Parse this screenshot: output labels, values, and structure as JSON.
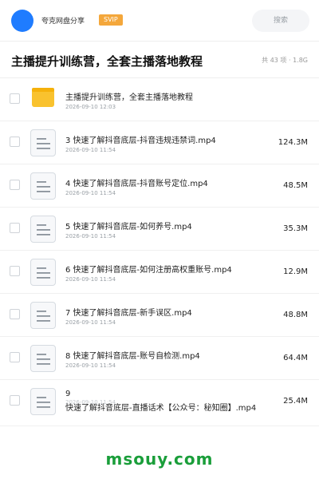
{
  "header": {
    "brand": "夸克网盘分享",
    "badge": "SVIP",
    "search_placeholder": "搜索"
  },
  "share": {
    "title": "主播提升训练营，全套主播落地教程",
    "summary": "共 43 项 · 1.8G"
  },
  "files": [
    {
      "name": "主播提升训练营，全套主播落地教程",
      "date": "2026-09-10 12:03",
      "size": "",
      "icon": "folder-icon"
    },
    {
      "name": "3 快速了解抖音底层-抖音违规违禁词.mp4",
      "date": "2026-09-10 11:54",
      "size": "124.3M",
      "icon": "file-icon"
    },
    {
      "name": "4 快速了解抖音底层-抖音账号定位.mp4",
      "date": "2026-09-10 11:54",
      "size": "48.5M",
      "icon": "file-icon"
    },
    {
      "name": "5 快速了解抖音底层-如何养号.mp4",
      "date": "2026-09-10 11:54",
      "size": "35.3M",
      "icon": "file-icon"
    },
    {
      "name": "6 快速了解抖音底层-如何注册高权重账号.mp4",
      "date": "2026-09-10 11:54",
      "size": "12.9M",
      "icon": "file-icon"
    },
    {
      "name": "7 快速了解抖音底层-新手误区.mp4",
      "date": "2026-09-10 11:54",
      "size": "48.8M",
      "icon": "file-icon"
    },
    {
      "name": "8 快速了解抖音底层-账号自检测.mp4",
      "date": "2026-09-10 11:54",
      "size": "64.4M",
      "icon": "file-icon"
    }
  ],
  "last_file": {
    "number": "9",
    "name": "快速了解抖音底层-直播话术【公众号：秘知圈】.mp4",
    "date": "2026-09-10 11:54",
    "size": "25.4M",
    "icon": "file-icon"
  },
  "watermark": "msouy.com",
  "colors": {
    "accent": "#1f7cff",
    "svip": "#f4a73b",
    "folder": "#f9c22e",
    "watermark": "#1a9e3a"
  }
}
